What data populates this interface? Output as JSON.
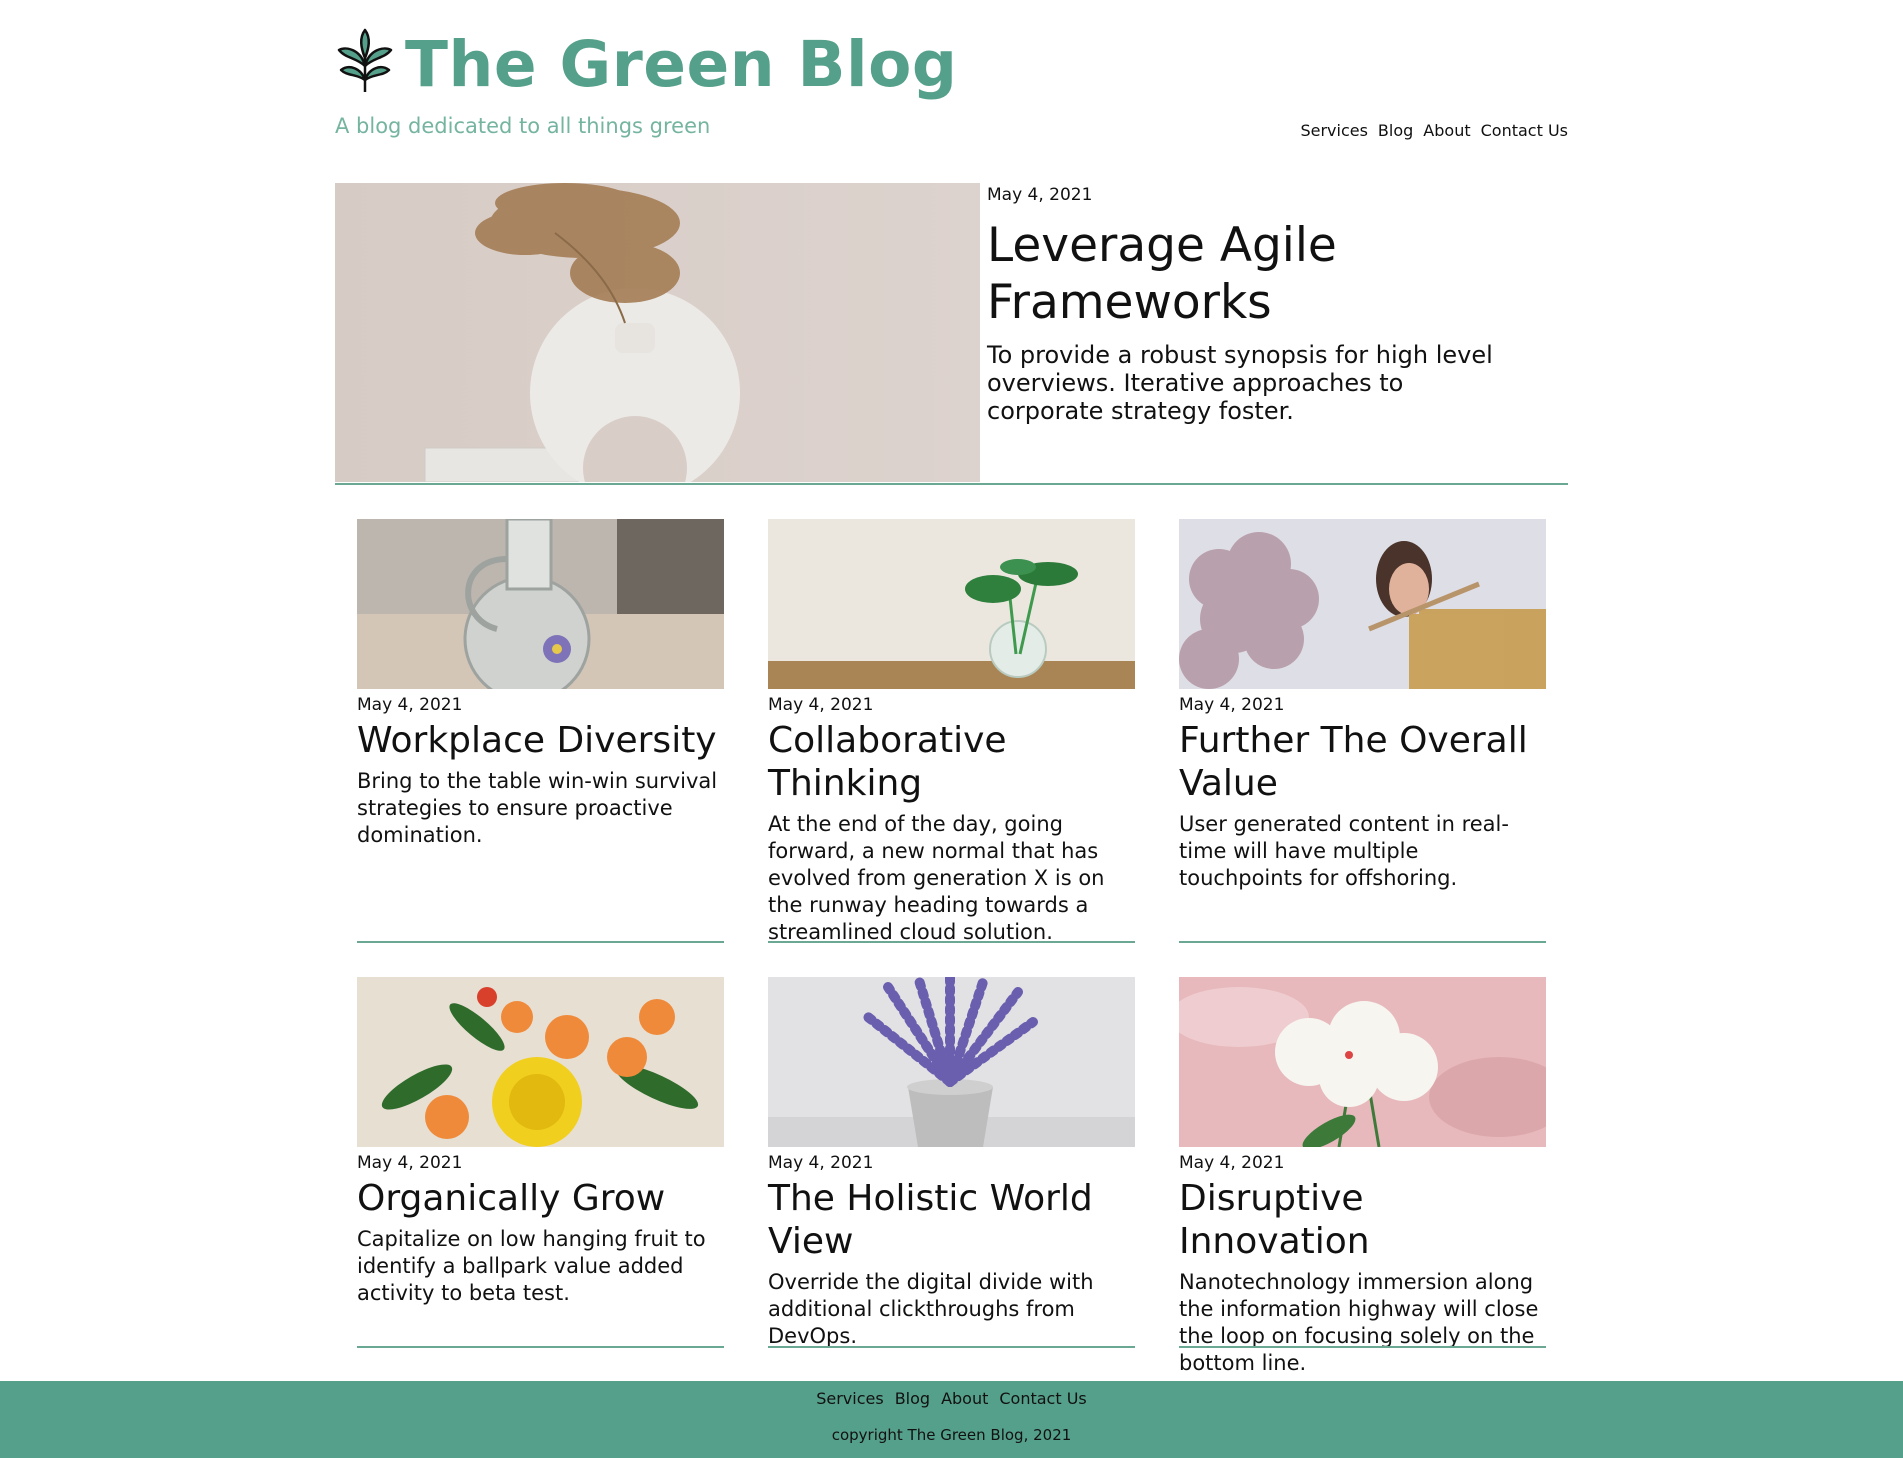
{
  "site": {
    "title": "The Green Blog",
    "tagline": "A blog dedicated to all things green",
    "brand_color": "#55a08a",
    "logo_icon": "leaf-icon"
  },
  "nav": {
    "items": [
      {
        "label": "Services"
      },
      {
        "label": "Blog"
      },
      {
        "label": "About"
      },
      {
        "label": "Contact Us"
      }
    ]
  },
  "featured": {
    "date": "May 4, 2021",
    "title": "Leverage Agile Frameworks",
    "excerpt": "To provide a robust synopsis for high level overviews. Iterative approaches to corporate strategy foster.",
    "image": "dried-pampas-grass-in-white-ring-vase-photo"
  },
  "posts": [
    {
      "date": "May 4, 2021",
      "title": "Workplace Diversity",
      "excerpt": "Bring to the table win-win survival strategies to ensure proactive domination.",
      "image": "glass-jug-with-purple-flower-photo"
    },
    {
      "date": "May 4, 2021",
      "title": "Collaborative Thinking",
      "excerpt": "At the end of the day, going forward, a new normal that has evolved from generation X is on the runway heading towards a streamlined cloud solution.",
      "image": "plant-cutting-in-glass-vase-photo"
    },
    {
      "date": "May 4, 2021",
      "title": "Further The Overall Value",
      "excerpt": "User generated content in real-time will have multiple touchpoints for offshoring.",
      "image": "woman-playing-flute-with-flowers-photo"
    },
    {
      "date": "May 4, 2021",
      "title": "Organically Grow",
      "excerpt": "Capitalize on low hanging fruit to identify a ballpark value added activity to beta test.",
      "image": "yellow-orange-bouquet-photo"
    },
    {
      "date": "May 4, 2021",
      "title": "The Holistic World View",
      "excerpt": "Override the digital divide with additional clickthroughs from DevOps.",
      "image": "lavender-in-concrete-pot-photo"
    },
    {
      "date": "May 4, 2021",
      "title": "Disruptive Innovation",
      "excerpt": "Nanotechnology immersion along the information highway will close the loop on focusing solely on the bottom line.",
      "image": "white-peonies-pink-background-photo"
    }
  ],
  "footer": {
    "copyright": "copyright The Green Blog, 2021"
  }
}
